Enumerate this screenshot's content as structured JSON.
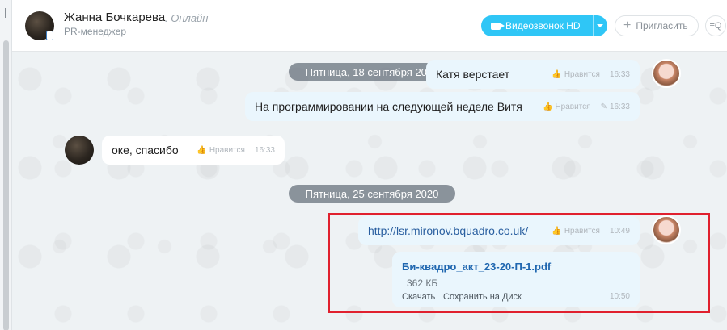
{
  "header": {
    "user_name": "Жанна Бочкарева",
    "user_status": ". Онлайн",
    "user_role": "PR-менеджер",
    "video_call_label": "Видеозвонок HD",
    "invite_label": "Пригласить",
    "search_icon": "≡Q"
  },
  "chat": {
    "date1": "Пятница, 18 сентября 2020",
    "date2": "Пятница, 25 сентября 2020",
    "messages": [
      {
        "text": "Катя верстает",
        "like": "Нравится",
        "time": "16:33"
      },
      {
        "text_before": "На программировании на ",
        "text_underline": "следующей неделе",
        "text_after": " Витя",
        "like": "Нравится",
        "time": "16:33"
      },
      {
        "text": "оке, спасибо",
        "like": "Нравится",
        "time": "16:33"
      },
      {
        "text": "http://lsr.mironov.bquadro.co.uk/",
        "like": "Нравится",
        "time": "10:49"
      }
    ],
    "file": {
      "name": "Би-квадро_акт_23-20-П-1.pdf",
      "size": "362 КБ",
      "download_label": "Скачать",
      "save_label": "Сохранить на Диск",
      "time": "10:50"
    }
  },
  "colors": {
    "accent": "#2fc6f6",
    "highlight": "#e0202e"
  }
}
